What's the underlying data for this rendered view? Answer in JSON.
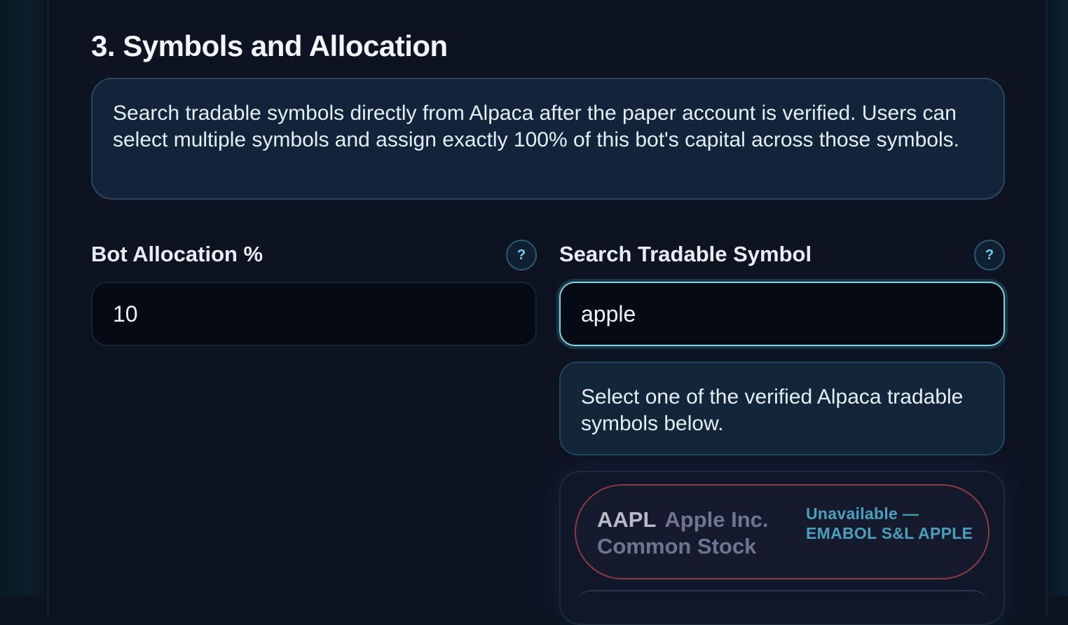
{
  "section": {
    "title": "3. Symbols and Allocation",
    "info": "Search tradable symbols directly from Alpaca after the paper account is verified. Users can select multiple symbols and assign exactly 100% of this bot's capital across those symbols."
  },
  "allocation": {
    "label": "Bot Allocation %",
    "value": "10",
    "help_glyph": "?"
  },
  "search": {
    "label": "Search Tradable Symbol",
    "value": "apple",
    "help_glyph": "?",
    "hint": "Select one of the verified Alpaca tradable symbols below."
  },
  "results": [
    {
      "ticker": "AAPL",
      "name": "Apple Inc. Common Stock",
      "status": "Unavailable — EMABOL S&L APPLE"
    }
  ],
  "colors": {
    "accent": "#7ed6e6",
    "unavailable_border": "#8a3a44",
    "status_text": "#4a9fbd"
  }
}
